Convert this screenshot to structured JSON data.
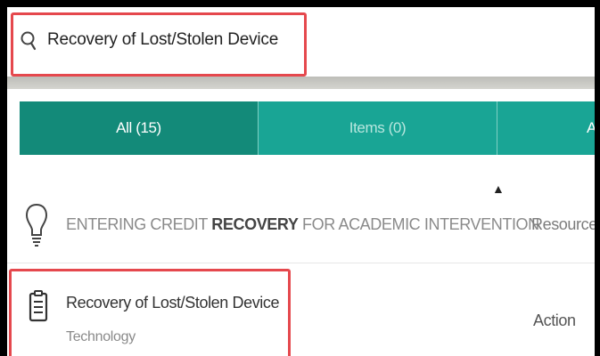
{
  "search": {
    "query": "Recovery of Lost/Stolen Device",
    "icon": "search-icon"
  },
  "tabs": [
    {
      "label": "All (15)",
      "active": true
    },
    {
      "label": "Items (0)",
      "active": false
    },
    {
      "label": "A",
      "active": false
    }
  ],
  "results": [
    {
      "title_before": "ENTERING CREDIT ",
      "title_match": "RECOVERY",
      "title_after": " FOR ACADEMIC INTERVENTION",
      "subtitle": "",
      "type": "Resource",
      "icon": "lightbulb-icon"
    },
    {
      "title": "Recovery of Lost/Stolen Device",
      "subtitle": "Technology",
      "type": "Action",
      "icon": "clipboard-icon"
    }
  ],
  "colors": {
    "tab_active": "#138a79",
    "tab_inactive": "#19a595",
    "highlight": "#e5484d"
  }
}
